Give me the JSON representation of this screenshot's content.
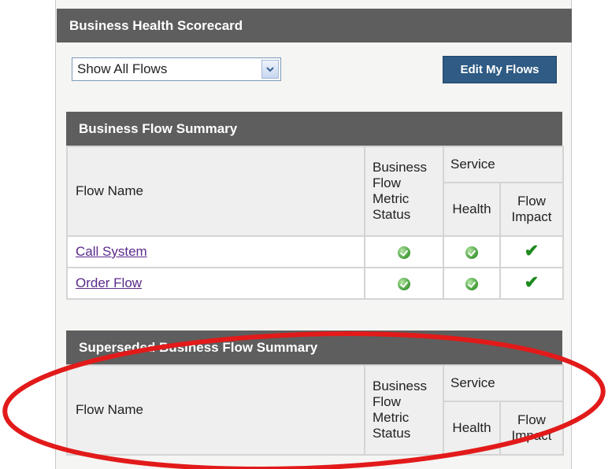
{
  "window": {
    "title": "Business Health Scorecard"
  },
  "filter": {
    "selected": "Show All Flows"
  },
  "toolbar": {
    "edit_label": "Edit My Flows"
  },
  "flow_summary": {
    "title": "Business Flow Summary",
    "headers": {
      "flow_name": "Flow Name",
      "bfm_line1": "Business",
      "bfm_line2": "Flow",
      "bfm_line3": "Metric",
      "bfm_line4": "Status",
      "service": "Service",
      "health": "Health",
      "impact_line1": "Flow",
      "impact_line2": "Impact"
    },
    "rows": [
      {
        "name": "Call System",
        "metric_status": "ok",
        "health": "ok",
        "impact": "check"
      },
      {
        "name": "Order Flow",
        "metric_status": "ok",
        "health": "ok",
        "impact": "check"
      }
    ]
  },
  "superseded_summary": {
    "title": "Superseded Business Flow Summary",
    "headers": {
      "flow_name": "Flow Name",
      "bfm_line1": "Business",
      "bfm_line2": "Flow",
      "bfm_line3": "Metric",
      "bfm_line4": "Status",
      "service": "Service",
      "health": "Health",
      "impact_line1": "Flow",
      "impact_line2": "Impact"
    },
    "rows": []
  },
  "colors": {
    "header_bg": "#5e5e5e",
    "button_bg": "#2f5b84",
    "link": "#5a2a8a",
    "status_ok": "#3f9a35",
    "annotation": "#e21a1a"
  }
}
